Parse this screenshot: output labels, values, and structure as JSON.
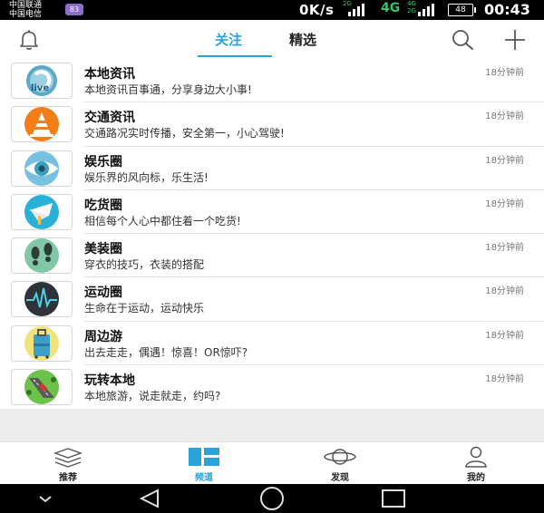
{
  "status_bar": {
    "carrier_1": "中国联通",
    "carrier_2": "中国电信",
    "sim_badge": "83",
    "net_speed": "0K/s",
    "net_2g": "2G",
    "net_4g": "4G",
    "net_4g_small": "4G",
    "net_2g_small": "2G",
    "battery": "48",
    "time": "00:43"
  },
  "header": {
    "tabs": [
      {
        "label": "关注",
        "active": true
      },
      {
        "label": "精选",
        "active": false
      }
    ],
    "icons": {
      "left": "bell-icon",
      "search": "search-icon",
      "add": "plus-icon"
    }
  },
  "channels": [
    {
      "title": "本地资讯",
      "desc": "本地资讯百事通，分享身边大小事!",
      "time": "18分钟前",
      "icon": "live-icon"
    },
    {
      "title": "交通资讯",
      "desc": "交通路况实时传播，安全第一，小心驾驶!",
      "time": "18分钟前",
      "icon": "traffic-cone-icon"
    },
    {
      "title": "娱乐圈",
      "desc": "娱乐界的风向标，乐生活!",
      "time": "18分钟前",
      "icon": "eye-icon"
    },
    {
      "title": "吃货圈",
      "desc": "相信每个人心中都住着一个吃货!",
      "time": "18分钟前",
      "icon": "food-icon"
    },
    {
      "title": "美装圈",
      "desc": "穿衣的技巧，衣装的搭配",
      "time": "18分钟前",
      "icon": "footprints-icon"
    },
    {
      "title": "运动圈",
      "desc": "生命在于运动，运动快乐",
      "time": "18分钟前",
      "icon": "heartbeat-icon"
    },
    {
      "title": "周边游",
      "desc": "出去走走，偶遇！惊喜！OR惊吓?",
      "time": "18分钟前",
      "icon": "luggage-icon"
    },
    {
      "title": "玩转本地",
      "desc": "本地旅游，说走就走，约吗?",
      "time": "18分钟前",
      "icon": "road-trip-icon"
    }
  ],
  "bottom_nav": [
    {
      "label": "推荐",
      "icon": "layers-icon",
      "active": false
    },
    {
      "label": "频道",
      "icon": "grid-icon",
      "active": true
    },
    {
      "label": "发现",
      "icon": "planet-icon",
      "active": false
    },
    {
      "label": "我的",
      "icon": "user-icon",
      "active": false
    }
  ],
  "colors": {
    "accent": "#2aa2da",
    "text": "#111111",
    "muted": "#777777",
    "background": "#ececec"
  }
}
